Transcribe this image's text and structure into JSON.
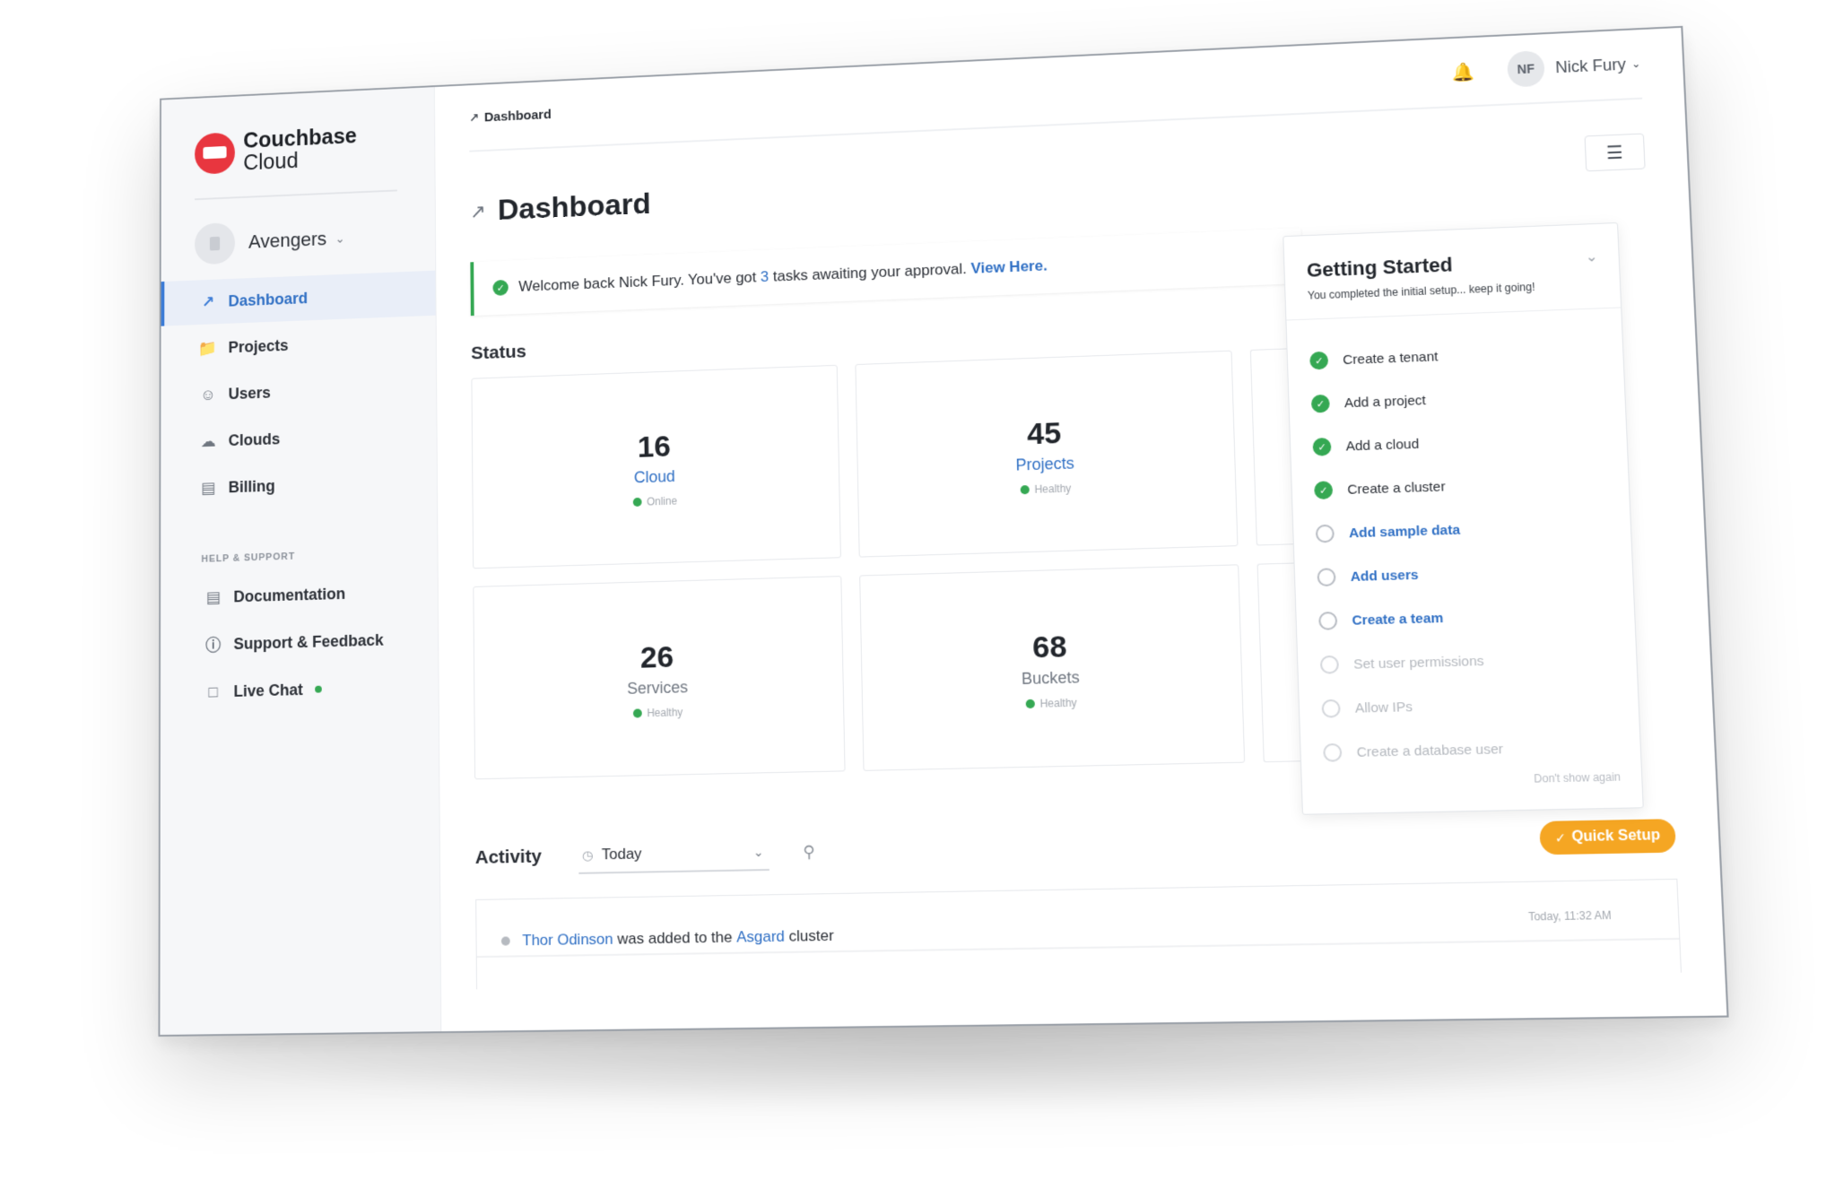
{
  "brand": {
    "name_line1": "Couchbase",
    "name_line2": "Cloud",
    "logo_color": "#e8363f"
  },
  "org": {
    "name": "Avengers"
  },
  "sidebar": {
    "items": [
      {
        "label": "Dashboard",
        "icon": "chart-line-icon",
        "active": true
      },
      {
        "label": "Projects",
        "icon": "folders-icon"
      },
      {
        "label": "Users",
        "icon": "users-icon"
      },
      {
        "label": "Clouds",
        "icon": "cloud-icon"
      },
      {
        "label": "Billing",
        "icon": "receipt-icon"
      }
    ],
    "help_title": "HELP & SUPPORT",
    "help_items": [
      {
        "label": "Documentation",
        "icon": "document-icon"
      },
      {
        "label": "Support & Feedback",
        "icon": "question-circle-icon"
      },
      {
        "label": "Live Chat",
        "icon": "chat-bubble-icon",
        "status": "online"
      }
    ]
  },
  "header": {
    "breadcrumb": "Dashboard",
    "user": {
      "initials": "NF",
      "name": "Nick Fury"
    }
  },
  "page": {
    "title": "Dashboard"
  },
  "welcome": {
    "prefix": "Welcome back Nick Fury. You've got",
    "count": "3",
    "suffix": "tasks awaiting your approval.",
    "link": "View Here."
  },
  "status": {
    "title": "Status",
    "cards": [
      {
        "value": "16",
        "label": "Cloud",
        "status": "Online",
        "label_link": true
      },
      {
        "value": "45",
        "label": "Projects",
        "status": "Healthy",
        "label_link": true
      },
      {
        "value": "26",
        "label": "Services",
        "status": "Healthy",
        "label_link": false
      },
      {
        "value": "68",
        "label": "Buckets",
        "status": "Healthy",
        "label_link": false
      }
    ]
  },
  "activity": {
    "title": "Activity",
    "range": "Today",
    "entry": {
      "user": "Thor Odinson",
      "text_mid": "was added to the",
      "cluster": "Asgard",
      "text_end": "cluster",
      "time": "Today, 11:32 AM"
    }
  },
  "quick_setup": {
    "label": "Quick Setup"
  },
  "getting_started": {
    "title": "Getting Started",
    "subtitle": "You completed the initial setup... keep it going!",
    "items": [
      {
        "label": "Create a tenant",
        "state": "done"
      },
      {
        "label": "Add a project",
        "state": "done"
      },
      {
        "label": "Add a cloud",
        "state": "done"
      },
      {
        "label": "Create a cluster",
        "state": "done"
      },
      {
        "label": "Add sample data",
        "state": "todo"
      },
      {
        "label": "Add users",
        "state": "todo"
      },
      {
        "label": "Create a team",
        "state": "todo"
      },
      {
        "label": "Set user permissions",
        "state": "locked"
      },
      {
        "label": "Allow IPs",
        "state": "locked"
      },
      {
        "label": "Create a database user",
        "state": "locked"
      }
    ],
    "dismiss": "Don't show again"
  },
  "colors": {
    "accent": "#2f6fc4",
    "success": "#35a853",
    "warning": "#f5a623"
  }
}
